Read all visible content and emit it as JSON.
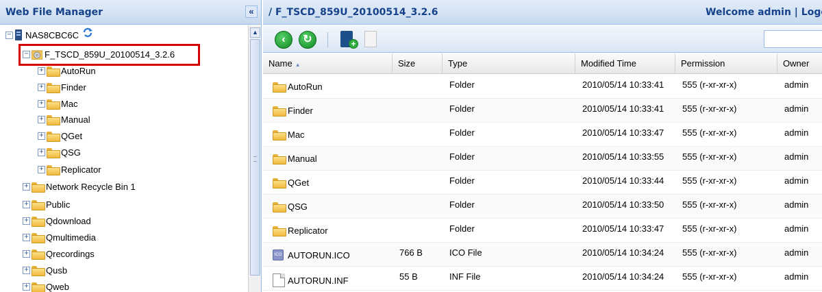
{
  "left_panel": {
    "title": "Web File Manager",
    "collapse_glyph": "«",
    "tree": [
      {
        "label": "NAS8CBC6C",
        "icon": "nas-icon",
        "expander": "−",
        "selected": false
      },
      {
        "label": "F_TSCD_859U_20100514_3.2.6",
        "icon": "disc-folder-icon",
        "expander": "−",
        "selected": true
      },
      {
        "label": "AutoRun",
        "icon": "folder-icon",
        "expander": "+"
      },
      {
        "label": "Finder",
        "icon": "folder-icon",
        "expander": "+"
      },
      {
        "label": "Mac",
        "icon": "folder-icon",
        "expander": "+"
      },
      {
        "label": "Manual",
        "icon": "folder-icon",
        "expander": "+"
      },
      {
        "label": "QGet",
        "icon": "folder-icon",
        "expander": "+"
      },
      {
        "label": "QSG",
        "icon": "folder-icon",
        "expander": "+"
      },
      {
        "label": "Replicator",
        "icon": "folder-icon",
        "expander": "+"
      },
      {
        "label": "Network Recycle Bin 1",
        "icon": "folder-icon",
        "expander": "+"
      },
      {
        "label": "Public",
        "icon": "folder-icon",
        "expander": "+"
      },
      {
        "label": "Qdownload",
        "icon": "folder-icon",
        "expander": "+"
      },
      {
        "label": "Qmultimedia",
        "icon": "folder-icon",
        "expander": "+"
      },
      {
        "label": "Qrecordings",
        "icon": "folder-icon",
        "expander": "+"
      },
      {
        "label": "Qusb",
        "icon": "folder-icon",
        "expander": "+"
      },
      {
        "label": "Qweb",
        "icon": "folder-icon",
        "expander": "+"
      }
    ]
  },
  "right_panel": {
    "path": "/ F_TSCD_859U_20100514_3.2.6",
    "welcome": "Welcome admin | Logout",
    "toolbar": {
      "back_glyph": "‹",
      "refresh_glyph": "↻",
      "newfolder_glyph": "+",
      "search_value": ""
    },
    "columns": {
      "name": "Name",
      "size": "Size",
      "type": "Type",
      "modified": "Modified Time",
      "permission": "Permission",
      "owner": "Owner"
    },
    "rows": [
      {
        "name": "AutoRun",
        "size": "",
        "type": "Folder",
        "modified": "2010/05/14 10:33:41",
        "permission": "555 (r-xr-xr-x)",
        "owner": "admin",
        "icon": "folder-icon"
      },
      {
        "name": "Finder",
        "size": "",
        "type": "Folder",
        "modified": "2010/05/14 10:33:41",
        "permission": "555 (r-xr-xr-x)",
        "owner": "admin",
        "icon": "folder-icon"
      },
      {
        "name": "Mac",
        "size": "",
        "type": "Folder",
        "modified": "2010/05/14 10:33:47",
        "permission": "555 (r-xr-xr-x)",
        "owner": "admin",
        "icon": "folder-icon"
      },
      {
        "name": "Manual",
        "size": "",
        "type": "Folder",
        "modified": "2010/05/14 10:33:55",
        "permission": "555 (r-xr-xr-x)",
        "owner": "admin",
        "icon": "folder-icon"
      },
      {
        "name": "QGet",
        "size": "",
        "type": "Folder",
        "modified": "2010/05/14 10:33:44",
        "permission": "555 (r-xr-xr-x)",
        "owner": "admin",
        "icon": "folder-icon"
      },
      {
        "name": "QSG",
        "size": "",
        "type": "Folder",
        "modified": "2010/05/14 10:33:50",
        "permission": "555 (r-xr-xr-x)",
        "owner": "admin",
        "icon": "folder-icon"
      },
      {
        "name": "Replicator",
        "size": "",
        "type": "Folder",
        "modified": "2010/05/14 10:33:47",
        "permission": "555 (r-xr-xr-x)",
        "owner": "admin",
        "icon": "folder-icon"
      },
      {
        "name": "AUTORUN.ICO",
        "size": "766 B",
        "type": "ICO File",
        "modified": "2010/05/14 10:34:24",
        "permission": "555 (r-xr-xr-x)",
        "owner": "admin",
        "icon": "ico-file-icon"
      },
      {
        "name": "AUTORUN.INF",
        "size": "55 B",
        "type": "INF File",
        "modified": "2010/05/14 10:34:24",
        "permission": "555 (r-xr-xr-x)",
        "owner": "admin",
        "icon": "inf-file-icon"
      }
    ]
  },
  "colors": {
    "header_text": "#15428b",
    "panel_border": "#99bbe8",
    "highlight_border": "#d40000",
    "folder_yellow": "#f5c54c"
  }
}
